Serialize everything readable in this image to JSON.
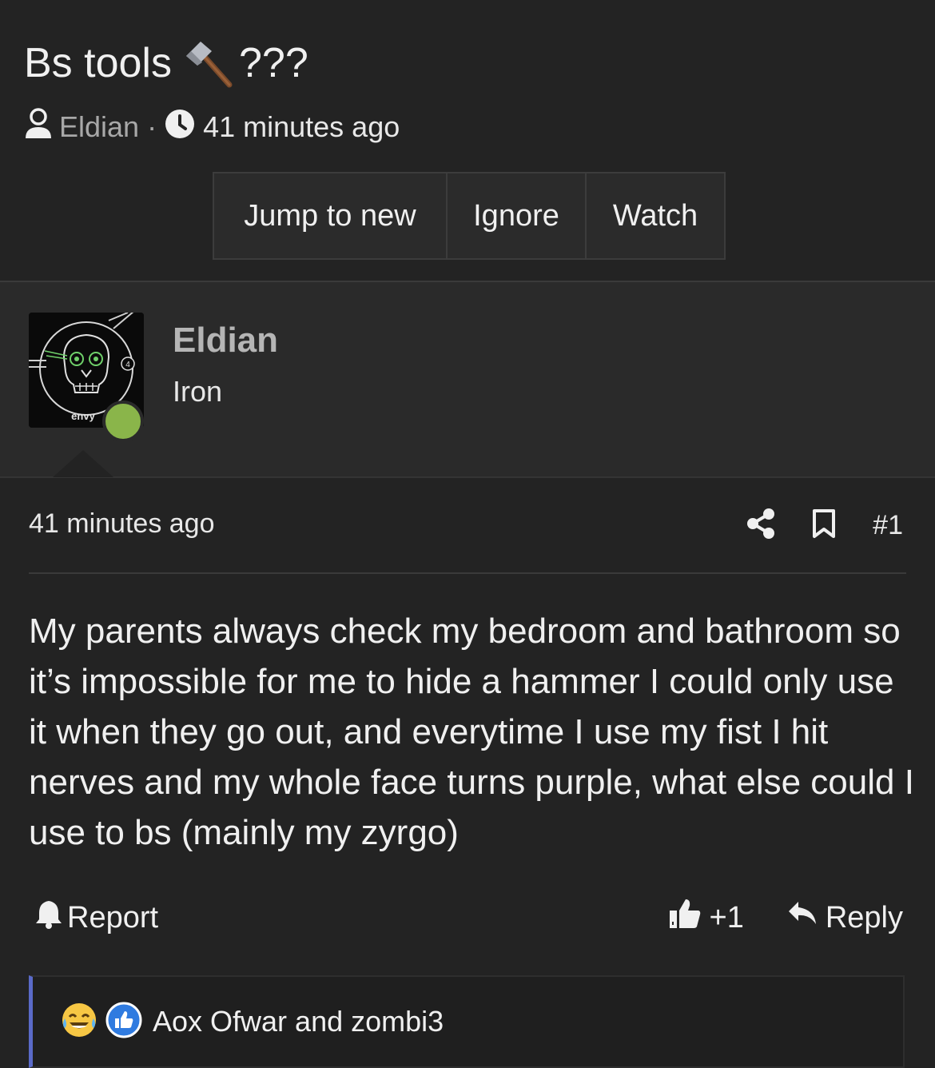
{
  "thread": {
    "title": "Bs tools",
    "title_suffix": "???",
    "title_emoji_icon": "hammer-icon",
    "author": "Eldian",
    "separator": "·",
    "time": "41 minutes ago"
  },
  "thread_buttons": {
    "jump": "Jump to new",
    "ignore": "Ignore",
    "watch": "Watch"
  },
  "poster": {
    "name": "Eldian",
    "rank": "Iron",
    "avatar_label": "envy",
    "avatar_badge": "4",
    "online_color": "#8ab54a"
  },
  "post": {
    "time": "41 minutes ago",
    "number": "#1",
    "body": "My parents always check my bedroom and bathroom so it’s impossible for me to hide a hammer I could only use it when they go out, and everytime I use my fist I hit nerves and my whole face turns purple, what else could I use to bs (mainly my zyrgo)",
    "report_label": "Report",
    "like_label": "+1",
    "reply_label": "Reply"
  },
  "reactions": {
    "names": "Aox Ofwar and zombi3",
    "icons": [
      "joy-tears-icon",
      "like-icon"
    ],
    "accent_color": "#5a6ac8"
  }
}
